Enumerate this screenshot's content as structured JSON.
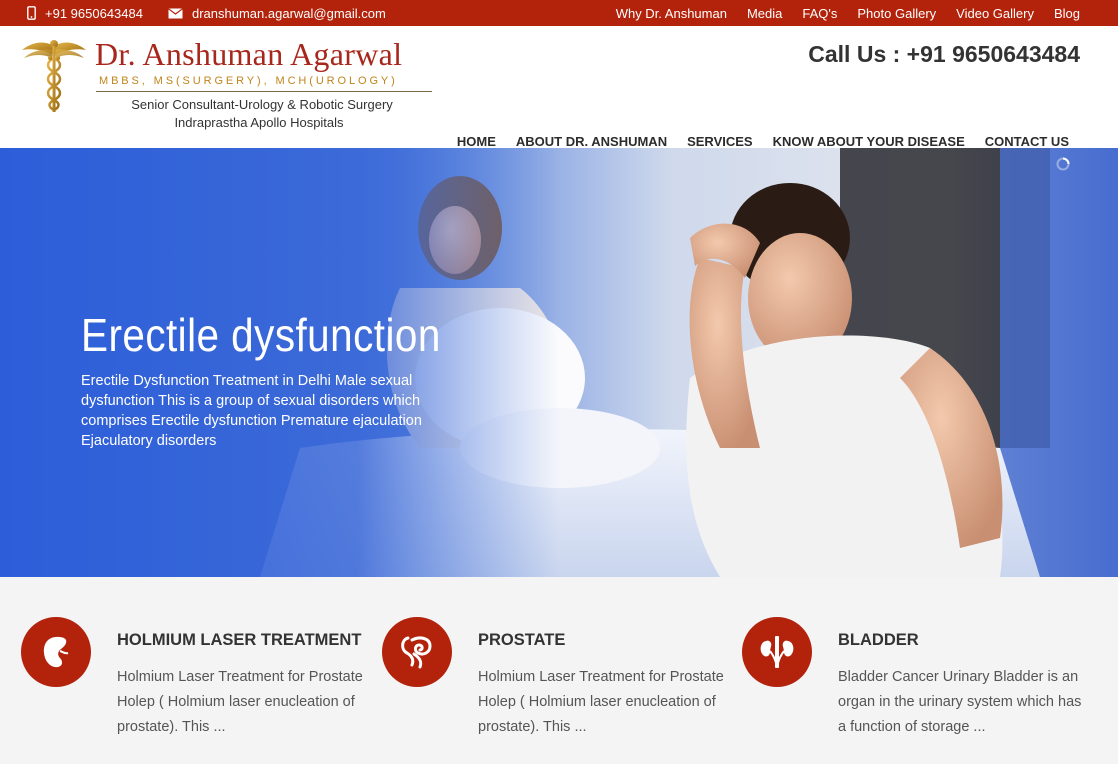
{
  "topbar": {
    "phone": "+91 9650643484",
    "email": "dranshuman.agarwal@gmail.com",
    "links": [
      "Why Dr. Anshuman",
      "Media",
      "FAQ's",
      "Photo Gallery",
      "Video Gallery",
      "Blog"
    ]
  },
  "logo": {
    "name": "Dr. Anshuman Agarwal",
    "degrees": "MBBS, MS(SURGERY), MCH(UROLOGY)",
    "subtitle1": "Senior Consultant-Urology & Robotic Surgery",
    "subtitle2": "Indraprastha Apollo Hospitals"
  },
  "header": {
    "callus": "Call Us : +91 9650643484"
  },
  "nav": {
    "items": [
      "HOME",
      "ABOUT DR. ANSHUMAN",
      "SERVICES",
      "KNOW ABOUT YOUR DISEASE",
      "CONTACT US"
    ]
  },
  "hero": {
    "title": "Erectile dysfunction",
    "description": "Erectile Dysfunction Treatment in Delhi Male sexual dysfunction This is a group of sexual disorders which comprises Erectile dysfunction Premature ejaculation Ejaculatory disorders"
  },
  "services": [
    {
      "title": "HOLMIUM LASER TREATMENT",
      "text": "Holmium Laser Treatment for Prostate Holep ( Holmium laser enucleation of prostate). This ...",
      "icon": "kidney-icon"
    },
    {
      "title": "PROSTATE",
      "text": "Holmium Laser Treatment for Prostate Holep ( Holmium laser enucleation of prostate). This ...",
      "icon": "prostate-icon"
    },
    {
      "title": "BLADDER",
      "text": "Bladder Cancer Urinary Bladder is an organ in the urinary system which has a function of storage ...",
      "icon": "urinary-system-icon"
    }
  ],
  "colors": {
    "brand_red": "#b3220b",
    "logo_red": "#a8271d",
    "logo_gold": "#c0841a",
    "hero_blue": "#3a66d8"
  }
}
